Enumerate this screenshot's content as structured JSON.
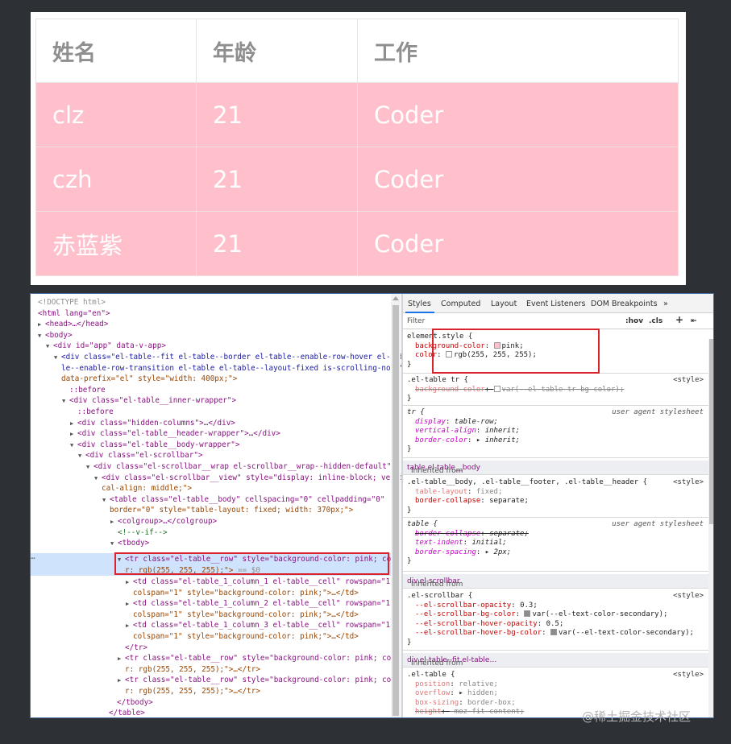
{
  "table": {
    "headers": [
      "姓名",
      "年龄",
      "工作"
    ],
    "rows": [
      [
        "clz",
        "21",
        "Coder"
      ],
      [
        "czh",
        "21",
        "Coder"
      ],
      [
        "赤蓝紫",
        "21",
        "Coder"
      ]
    ],
    "row_bg_color": "#ffc0cb",
    "row_text_color": "#ffffff"
  },
  "devtools": {
    "elements": {
      "doctype": "<!DOCTYPE html>",
      "l_html": "<html lang=\"en\">",
      "l_head": "<head>…</head>",
      "l_body": "<body>",
      "l_app": "<div id=\"app\" data-v-app>",
      "l_table1": "<div class=\"el-table--fit el-table--border el-table--enable-row-hover el-tab",
      "l_table2": "le--enable-row-transition el-table el-table--layout-fixed is-scrolling-none\"",
      "l_table3": "data-prefix=\"el\" style=\"width: 400px;\">",
      "l_before1": "::before",
      "l_inner": "<div class=\"el-table__inner-wrapper\">",
      "l_before2": "::before",
      "l_hidden": "<div class=\"hidden-columns\">…</div>",
      "l_header": "<div class=\"el-table__header-wrapper\">…</div>",
      "l_bodywrap": "<div class=\"el-table__body-wrapper\">",
      "l_scrollbar": "<div class=\"el-scrollbar\">",
      "l_wrap": "<div class=\"el-scrollbar__wrap el-scrollbar__wrap--hidden-default\">",
      "l_view1": "<div class=\"el-scrollbar__view\" style=\"display: inline-block; verti",
      "l_view2": "cal-align: middle;\">",
      "l_tbl1": "<table class=\"el-table__body\" cellspacing=\"0\" cellpadding=\"0\"",
      "l_tbl2": "border=\"0\" style=\"table-layout: fixed; width: 370px;\">",
      "l_colgroup": "<colgroup>…</colgroup>",
      "l_comment": "<!--v-if-->",
      "l_tbody": "<tbody>",
      "l_tr1a": "<tr class=\"el-table__row\" style=\"background-color: pink; colo",
      "l_tr1b": "r: rgb(255, 255, 255);\">",
      "l_tr1b_eq": " == $0",
      "l_td1a": "<td class=\"el-table_1_column_1 el-table__cell\" rowspan=\"1\"",
      "l_td1b": "colspan=\"1\" style=\"background-color: pink;\">…</td>",
      "l_td2a": "<td class=\"el-table_1_column_2 el-table__cell\" rowspan=\"1\"",
      "l_td2b": "colspan=\"1\" style=\"background-color: pink;\">…</td>",
      "l_td3a": "<td class=\"el-table_1_column_3 el-table__cell\" rowspan=\"1\"",
      "l_td3b": "colspan=\"1\" style=\"background-color: pink;\">…</td>",
      "l_trclose": "</tr>",
      "l_tr2a": "<tr class=\"el-table__row\" style=\"background-color: pink; colo",
      "l_tr2b": "r: rgb(255, 255, 255);\">…</tr>",
      "l_tr3a": "<tr class=\"el-table__row\" style=\"background-color: pink; colo",
      "l_tr3b": "r: rgb(255, 255, 255);\">…</tr>",
      "l_tbodyclose": "</tbody>",
      "l_tableclose": "</table>",
      "gutter_dots": "…"
    },
    "styles_tabs": [
      "Styles",
      "Computed",
      "Layout",
      "Event Listeners",
      "DOM Breakpoints",
      "»"
    ],
    "filter": {
      "placeholder": "Filter",
      "hov": ":hov",
      "cls": ".cls",
      "plus": "+",
      "toggle": "⇤"
    },
    "rules": {
      "r1_sel": "element.style {",
      "r1_p1n": "background-color",
      "r1_p1v": "pink;",
      "r1_p2n": "color",
      "r1_p2v": "rgb(255, 255, 255);",
      "close": "}",
      "r2_sel": ".el-table tr {",
      "r2_src": "<style>",
      "r2_p1n": "background-color",
      "r2_p1v": "var(--el-table-tr-bg-color);",
      "r3_sel": "tr {",
      "r3_src": "user agent stylesheet",
      "r3_p1n": "display",
      "r3_p1v": "table-row;",
      "r3_p2n": "vertical-align",
      "r3_p2v": "inherit;",
      "r3_p3n": "border-color",
      "r3_p3v": "inherit;",
      "inh1_pre": "Inherited from ",
      "inh1_el": "table.el-table__body",
      "r4_sel": ".el-table__body, .el-table__footer, .el-table__header {",
      "r4_src": "<style>",
      "r4_p1n": "table-layout",
      "r4_p1v": "fixed;",
      "r4_p2n": "border-collapse",
      "r4_p2v": "separate;",
      "r5_sel": "table {",
      "r5_src": "user agent stylesheet",
      "r5_p1n": "border-collapse",
      "r5_p1v": "separate;",
      "r5_p2n": "text-indent",
      "r5_p2v": "initial;",
      "r5_p3n": "border-spacing",
      "r5_p3v": "2px;",
      "inh2_pre": "Inherited from ",
      "inh2_el": "div.el-scrollbar",
      "r6_sel": ".el-scrollbar {",
      "r6_src": "<style>",
      "r6_p1n": "--el-scrollbar-opacity",
      "r6_p1v": "0.3;",
      "r6_p2n": "--el-scrollbar-bg-color",
      "r6_p2v": "var(--el-text-color-secondary);",
      "r6_p3n": "--el-scrollbar-hover-opacity",
      "r6_p3v": "0.5;",
      "r6_p4n": "--el-scrollbar-hover-bg-color",
      "r6_p4v": "var(--el-text-color-secondary);",
      "inh3_pre": "Inherited from ",
      "inh3_el": "div.el-table--fit.el-table…",
      "r7_sel": ".el-table {",
      "r7_src": "<style>",
      "r7_p1n": "position",
      "r7_p1v": "relative;",
      "r7_p2n": "overflow",
      "r7_p2v": "hidden;",
      "r7_p3n": "box-sizing",
      "r7_p3v": "border-box;",
      "r7_p4n": "height",
      "r7_p4v": "-moz-fit-content;"
    },
    "swatch_colors": {
      "pink": "#ffc0cb",
      "white": "#ffffff",
      "gray": "#8c8c8c"
    }
  },
  "watermark": "@稀土掘金技术社区"
}
